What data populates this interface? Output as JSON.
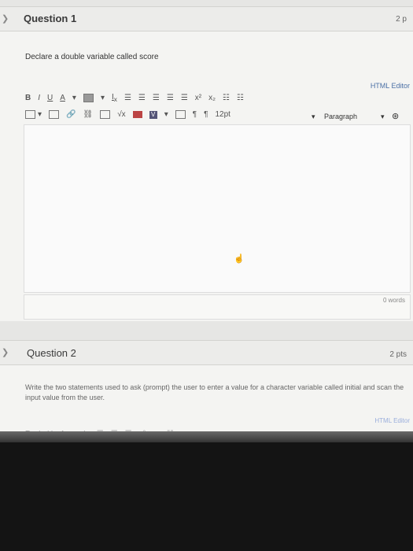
{
  "question1": {
    "title": "Question 1",
    "points": "2 p",
    "prompt": "Declare a double variable called score",
    "html_editor_link": "HTML Editor",
    "toolbar_row1": [
      "B",
      "I",
      "U",
      "A",
      "▾",
      "▩",
      "▾",
      "Ix",
      "≡",
      "≡",
      "≡",
      "≡",
      "≡",
      "x²",
      "x₂",
      "☷",
      "☷"
    ],
    "font_size": "12pt",
    "paragraph_select": "Paragraph",
    "word_count": "0 words"
  },
  "question2": {
    "title": "Question 2",
    "points": "2 pts",
    "prompt": "Write the two statements used to ask (prompt) the user to enter a value for a character variable called initial and scan the input value from the user.",
    "html_editor_link": "HTML Editor"
  },
  "colors": {
    "header_bg": "#ececea",
    "body_bg": "#f4f4f2",
    "link": "#4a6fa5",
    "bezel": "#141414"
  }
}
